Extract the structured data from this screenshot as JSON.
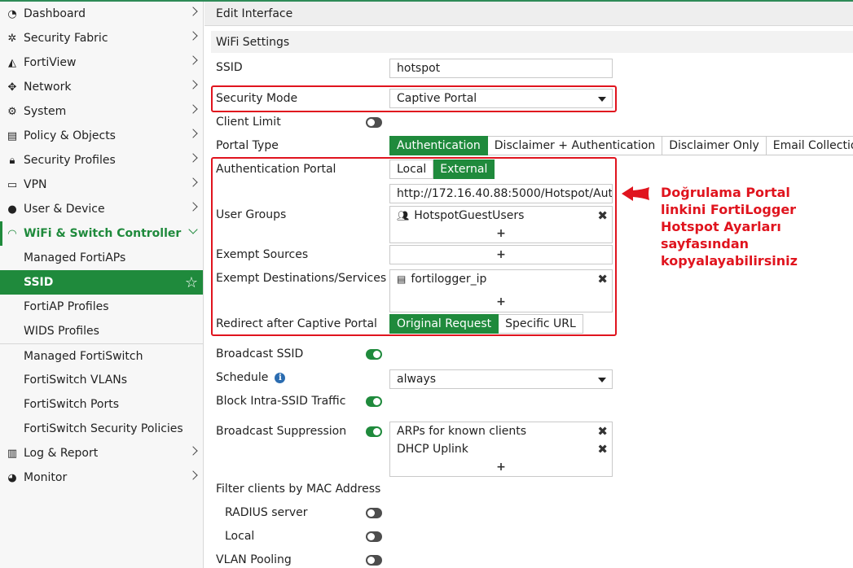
{
  "sidebar": {
    "items": [
      {
        "label": "Dashboard",
        "icon": "dashboard-icon"
      },
      {
        "label": "Security Fabric",
        "icon": "security-fabric-icon"
      },
      {
        "label": "FortiView",
        "icon": "fortiview-icon"
      },
      {
        "label": "Network",
        "icon": "network-icon"
      },
      {
        "label": "System",
        "icon": "gear-icon"
      },
      {
        "label": "Policy & Objects",
        "icon": "policy-icon"
      },
      {
        "label": "Security Profiles",
        "icon": "lock-icon"
      },
      {
        "label": "VPN",
        "icon": "monitor-icon"
      },
      {
        "label": "User & Device",
        "icon": "user-icon"
      }
    ],
    "open_item": {
      "label": "WiFi & Switch Controller",
      "icon": "wifi-icon"
    },
    "sub_items": [
      "Managed FortiAPs",
      "SSID",
      "FortiAP Profiles",
      "WIDS Profiles",
      "Managed FortiSwitch",
      "FortiSwitch VLANs",
      "FortiSwitch Ports",
      "FortiSwitch Security Policies"
    ],
    "bottom_items": [
      {
        "label": "Log & Report",
        "icon": "bar-chart-icon"
      },
      {
        "label": "Monitor",
        "icon": "pie-chart-icon"
      }
    ]
  },
  "header": {
    "title": "Edit Interface"
  },
  "section": {
    "title": "WiFi Settings"
  },
  "form": {
    "ssid_label": "SSID",
    "ssid_value": "hotspot",
    "security_mode_label": "Security Mode",
    "security_mode_value": "Captive Portal",
    "client_limit_label": "Client Limit",
    "client_limit_on": false,
    "portal_type_label": "Portal Type",
    "portal_type_options": [
      "Authentication",
      "Disclaimer + Authentication",
      "Disclaimer Only",
      "Email Collection"
    ],
    "portal_type_selected": "Authentication",
    "auth_portal_label": "Authentication Portal",
    "auth_portal_options": [
      "Local",
      "External"
    ],
    "auth_portal_selected": "External",
    "auth_portal_url": "http://172.16.40.88:5000/Hotspot/Aut",
    "user_groups_label": "User Groups",
    "user_groups": [
      "HotspotGuestUsers"
    ],
    "exempt_sources_label": "Exempt Sources",
    "exempt_dest_label": "Exempt Destinations/Services",
    "exempt_dest": [
      "fortilogger_ip"
    ],
    "redirect_label": "Redirect after Captive Portal",
    "redirect_options": [
      "Original Request",
      "Specific URL"
    ],
    "redirect_selected": "Original Request",
    "broadcast_ssid_label": "Broadcast SSID",
    "broadcast_ssid_on": true,
    "schedule_label": "Schedule",
    "schedule_value": "always",
    "block_intra_label": "Block Intra-SSID Traffic",
    "block_intra_on": true,
    "broadcast_suppression_label": "Broadcast Suppression",
    "broadcast_suppression_on": true,
    "broadcast_suppression_items": [
      "ARPs for known clients",
      "DHCP Uplink"
    ],
    "filter_mac_label": "Filter clients by MAC Address",
    "radius_label": "RADIUS server",
    "radius_on": false,
    "local_label": "Local",
    "local_on": false,
    "vlan_pooling_label": "VLAN Pooling",
    "vlan_pooling_on": false,
    "add_symbol": "+",
    "remove_symbol": "✖"
  },
  "annotation": {
    "text": "Doğrulama Portal linkini FortiLogger Hotspot Ayarları sayfasından kopyalayabilirsiniz",
    "color": "#e0141e"
  },
  "colors": {
    "accent": "#1f8a3c",
    "highlight": "#e0141e"
  }
}
